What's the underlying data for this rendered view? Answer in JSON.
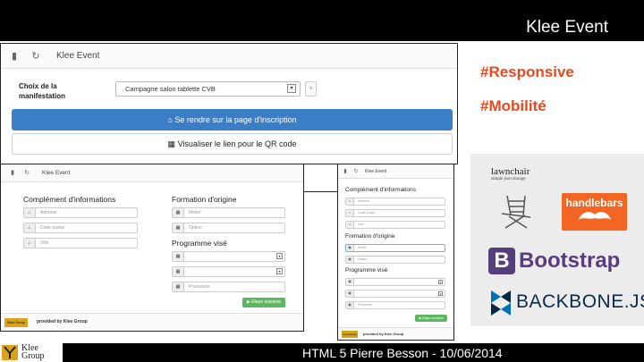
{
  "slide": {
    "title": "Klee Event",
    "footer": "HTML 5 Pierre Besson -  10/06/2014",
    "company_logo": "Klee Group"
  },
  "desktop": {
    "app_title": "Klee Event",
    "choix_label": "Choix de la manifestation",
    "select_value": "Campagne salon tablette CVB",
    "register_button": "Se rendre sur la page d'inscription",
    "qr_button": "Visualiser le lien pour le QR code",
    "icons": [
      "signal-icon",
      "refresh-icon",
      "home-icon",
      "qrcode-icon"
    ]
  },
  "tablet": {
    "app_title": "Klee Event",
    "complement_title": "Complément d'informations",
    "formation_title": "Formation d'origine",
    "programme_title": "Programme visé",
    "fields": {
      "adresse": "Adresse",
      "code_postal": "Code postal",
      "ville": "Ville",
      "metier": "Metier",
      "option": "Option",
      "precisions": "Précisions"
    },
    "next_button": "Etape suivante",
    "footer_text": "provided by Klee Group",
    "footer_logo": "Klee Group"
  },
  "phone": {
    "app_title": "Klee Event",
    "complement_title": "Complément d'informations",
    "formation_title": "Formation d'origine",
    "programme_title": "Programme visé",
    "fields": {
      "adresse": "Adresse",
      "code_postal": "Code postal",
      "ville": "Ville",
      "metier": "Metier",
      "option": "Option",
      "precisions": "Précisions"
    },
    "next_button": "Etape suivante",
    "footer_text": "provided by Klee Group",
    "footer_logo": "Klee Group"
  },
  "tags": [
    "#Responsive",
    "#Mobilité"
  ],
  "logos": {
    "lawnchair": "lawnchair",
    "lawnchair_sub": "simple json storage",
    "handlebars": "handlebars",
    "bootstrap_letter": "B",
    "bootstrap": "Bootstrap",
    "backbone": "BACKBONE.JS"
  },
  "colors": {
    "tag": "#e8491d",
    "primary_button": "#3a7ec8",
    "bootstrap": "#563d7c",
    "handlebars": "#f26522",
    "next_button": "#5cb85c"
  }
}
